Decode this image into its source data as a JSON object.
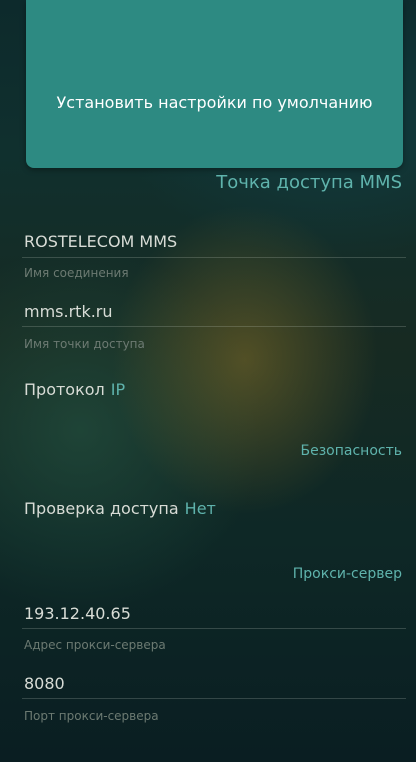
{
  "reset_button": {
    "label": "Установить настройки по умолчанию"
  },
  "mms_section": {
    "title": "Точка доступа MMS",
    "connection_name": {
      "value": "ROSTELECOM MMS",
      "caption": "Имя соединения"
    },
    "access_point_name": {
      "value": "mms.rtk.ru",
      "caption": "Имя точки доступа"
    },
    "protocol": {
      "label": "Протокол",
      "value": "IP"
    }
  },
  "security_section": {
    "title": "Безопасность",
    "auth_check": {
      "label": "Проверка доступа",
      "value": "Нет"
    }
  },
  "proxy_section": {
    "title": "Прокси-сервер",
    "proxy_address": {
      "value": "193.12.40.65",
      "caption": "Адрес прокси-сервера"
    },
    "proxy_port": {
      "value": "8080",
      "caption": "Порт прокси-сервера"
    }
  }
}
